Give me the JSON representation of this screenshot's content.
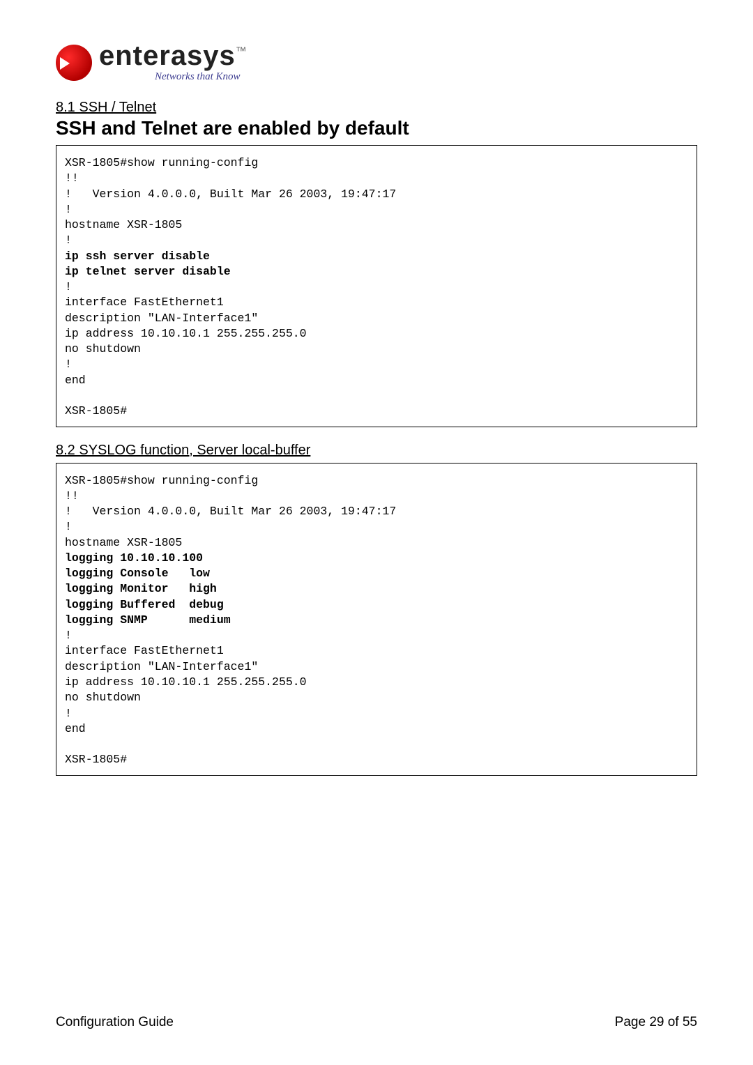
{
  "brand": "enterasys",
  "tagline": "Networks that Know",
  "section1": {
    "num": "8.1 SSH / Telnet",
    "title": "SSH and Telnet are enabled by default"
  },
  "code1": {
    "l01": "XSR-1805#show running-config",
    "l02": "!!",
    "l03": "!   Version 4.0.0.0, Built Mar 26 2003, 19:47:17",
    "l04": "!",
    "l05": "hostname XSR-1805",
    "l06": "!",
    "l07": "ip ssh server disable",
    "l08": "ip telnet server disable",
    "l09": "!",
    "l10": "interface FastEthernet1",
    "l11": "description \"LAN-Interface1\"",
    "l12": "ip address 10.10.10.1 255.255.255.0",
    "l13": "no shutdown",
    "l14": "!",
    "l15": "end",
    "l16": "",
    "l17": "XSR-1805#"
  },
  "section2": {
    "num": "8.2 SYSLOG function, Server local-buffer"
  },
  "code2": {
    "l01": "XSR-1805#show running-config",
    "l02": "!!",
    "l03": "!   Version 4.0.0.0, Built Mar 26 2003, 19:47:17",
    "l04": "!",
    "l05": "hostname XSR-1805",
    "l06": "logging 10.10.10.100",
    "l07": "logging Console   low",
    "l08": "logging Monitor   high",
    "l09": "logging Buffered  debug",
    "l10": "logging SNMP      medium",
    "l11": "!",
    "l12": "interface FastEthernet1",
    "l13": "description \"LAN-Interface1\"",
    "l14": "ip address 10.10.10.1 255.255.255.0",
    "l15": "no shutdown",
    "l16": "!",
    "l17": "end",
    "l18": "",
    "l19": "XSR-1805#"
  },
  "footer": {
    "left": "Configuration Guide",
    "right": "Page 29 of 55"
  }
}
